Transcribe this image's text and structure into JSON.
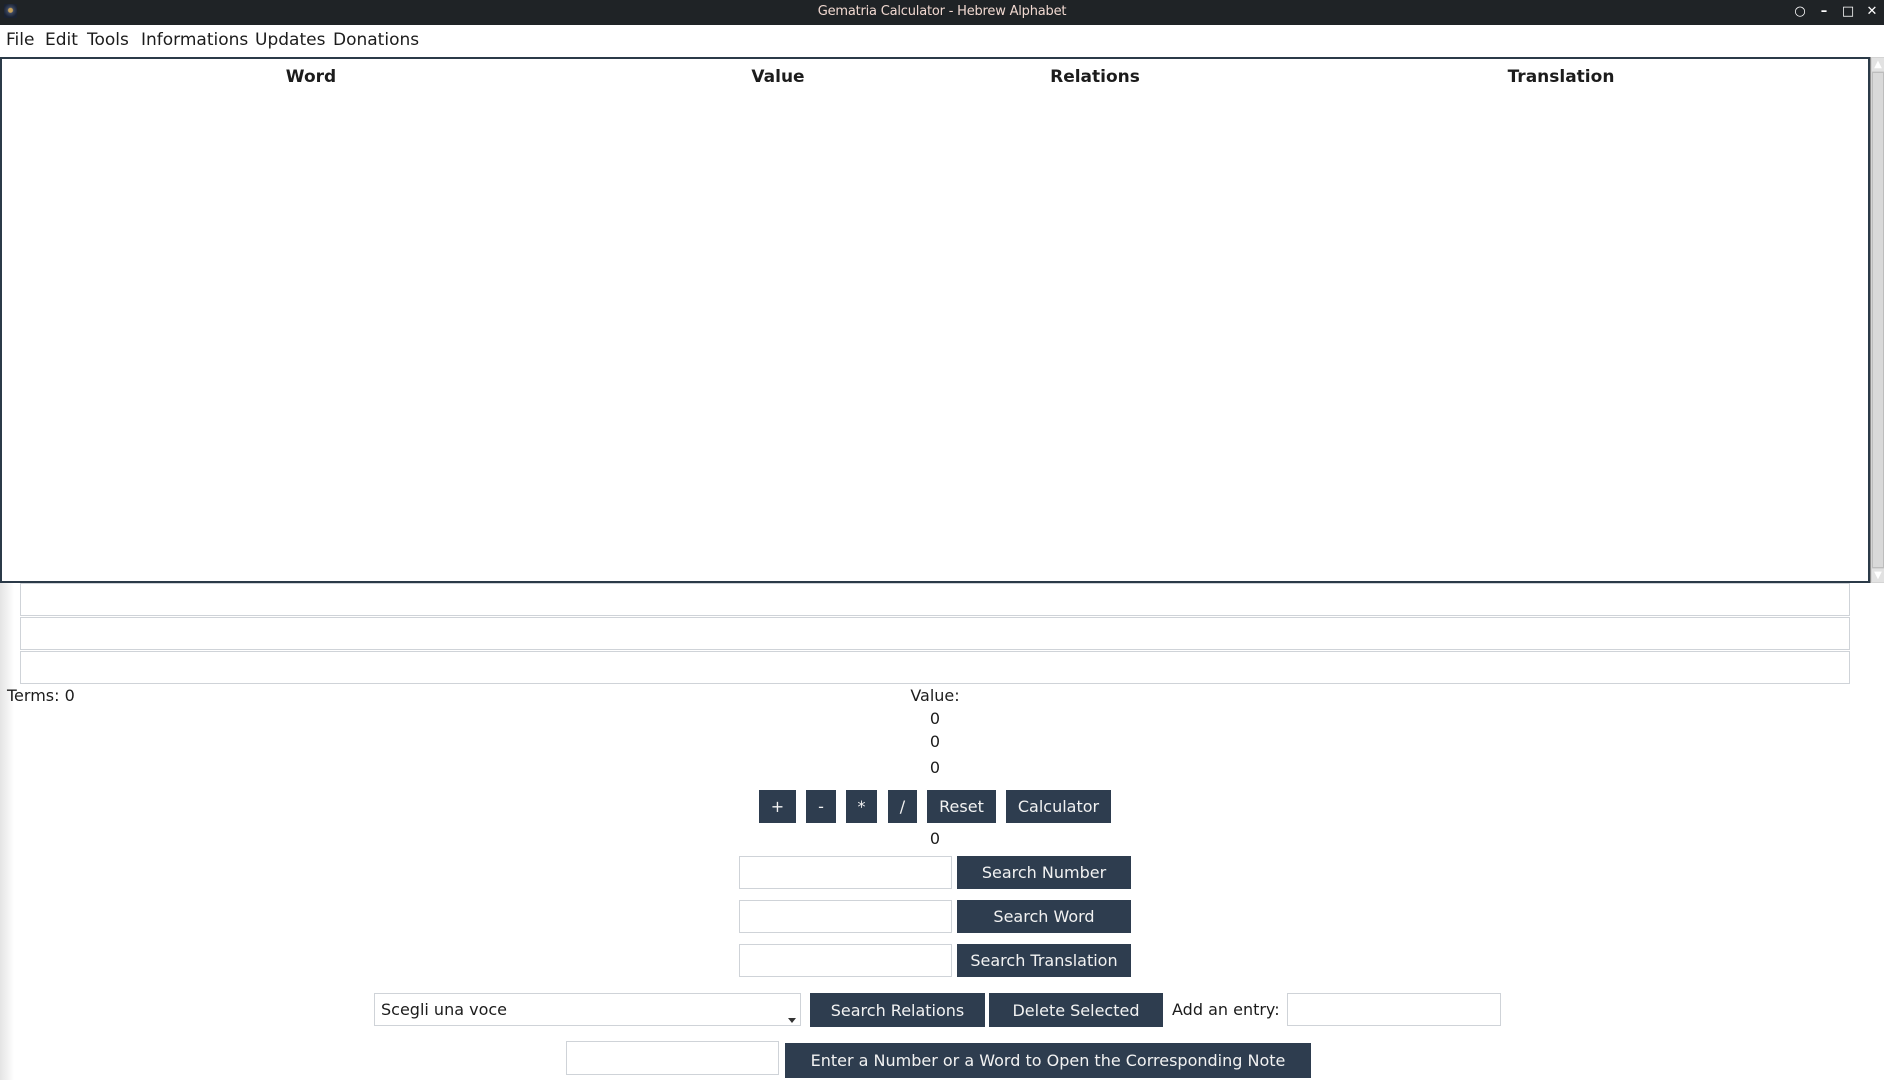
{
  "window": {
    "title": "Gematria Calculator - Hebrew Alphabet",
    "controls": {
      "pin_icon": "○",
      "minimize_icon": "–",
      "maximize_icon": "□",
      "close_icon": "✕"
    }
  },
  "menubar": {
    "items": [
      {
        "label": "File"
      },
      {
        "label": "Edit"
      },
      {
        "label": "Tools"
      },
      {
        "label": "Informations"
      },
      {
        "label": "Updates"
      },
      {
        "label": "Donations"
      }
    ]
  },
  "table": {
    "columns": [
      "Word",
      "Value",
      "Relations",
      "Translation"
    ],
    "rows": [],
    "scroll_up_icon": "▲",
    "scroll_down_icon": "▼"
  },
  "entries": {
    "field1": "",
    "field2": "",
    "field3": ""
  },
  "status": {
    "terms_label": "Terms: 0",
    "value_label": "Value:",
    "value_lines": [
      "0",
      "0",
      "0"
    ],
    "result": "0"
  },
  "operations": {
    "plus": "+",
    "minus": "-",
    "multiply": "*",
    "divide": "/",
    "reset": "Reset",
    "calculator": "Calculator"
  },
  "search": {
    "number": {
      "value": "",
      "button": "Search Number"
    },
    "word": {
      "value": "",
      "button": "Search Word"
    },
    "translation": {
      "value": "",
      "button": "Search Translation"
    }
  },
  "relations": {
    "combo_selected": "Scegli una voce",
    "search_button": "Search Relations",
    "delete_button": "Delete Selected",
    "add_entry_label": "Add an entry:",
    "add_entry_value": ""
  },
  "note": {
    "input_value": "",
    "button": "Enter a Number or a Word to Open the Corresponding Note"
  }
}
